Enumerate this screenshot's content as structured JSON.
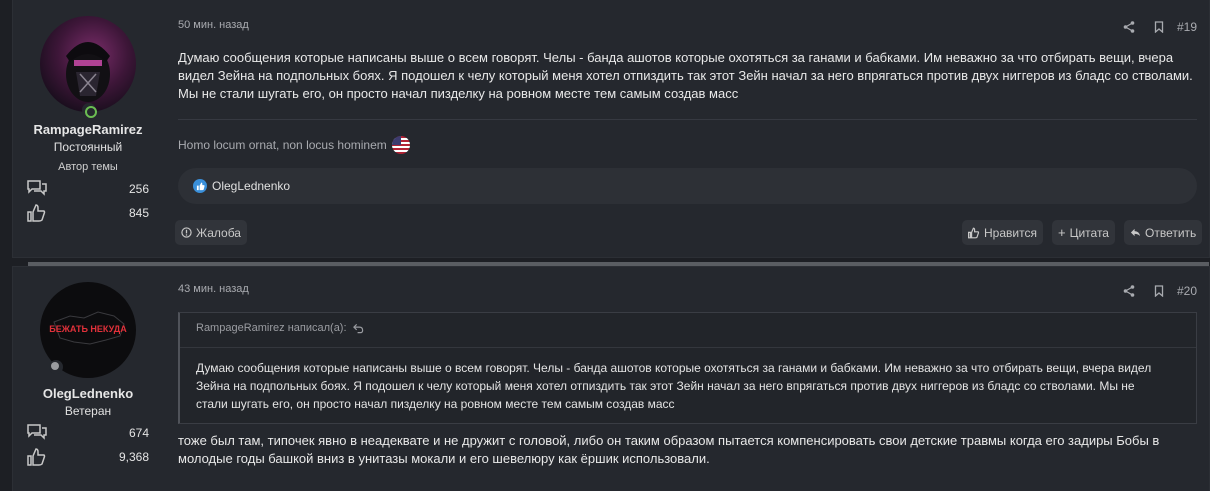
{
  "posts": [
    {
      "user": {
        "name": "RampageRamirez",
        "title": "Постоянный",
        "badge": "Автор темы",
        "messages": "256",
        "reactions": "845"
      },
      "date": "50 мин. назад",
      "number": "#19",
      "text": "Думаю сообщения которые написаны выше о всем говорят. Челы - банда ашотов которые охотяться за ганами и бабками. Им неважно за что отбирать вещи, вчера видел Зейна на подпольных боях. Я подошел к челу который меня хотел отпиздить так этот Зейн начал за него впрягаться против двух ниггеров из бладс со стволами. Мы не стали шугать его, он просто начал пизделку на ровном месте тем самым создав масс",
      "signature": "Homo locum ornat, non locus hominem",
      "reactions_by": "OlegLednenko",
      "buttons": {
        "report": "Жалоба",
        "like": "Нравится",
        "quote": "Цитата",
        "reply": "Ответить"
      }
    },
    {
      "user": {
        "name": "OlegLednenko",
        "title": "Ветеран",
        "avatar_text": "БЕЖАТЬ НЕКУДА",
        "messages": "674",
        "reactions": "9,368"
      },
      "date": "43 мин. назад",
      "number": "#20",
      "quote": {
        "author": "RampageRamirez написал(а):",
        "text": "Думаю сообщения которые написаны выше о всем говорят. Челы - банда ашотов которые охотяться за ганами и бабками. Им неважно за что отбирать вещи, вчера видел Зейна на подпольных боях. Я подошел к челу который меня хотел отпиздить так этот Зейн начал за него впрягаться против двух ниггеров из бладс со стволами. Мы не стали шугать его, он просто начал пизделку на ровном месте тем самым создав масс"
      },
      "text": "тоже был там, типочек явно в неадеквате и не дружит с головой, либо он таким образом пытается компенсировать свои детские травмы когда его задиры Бобы в молодые годы башкой вниз в унитазы мокали и его шевелюру как ёршик использовали."
    }
  ],
  "colors": {
    "background": "#1d1f24",
    "post_bg": "#25282e",
    "online": "#6bbd52",
    "like": "#3a8fd9"
  }
}
